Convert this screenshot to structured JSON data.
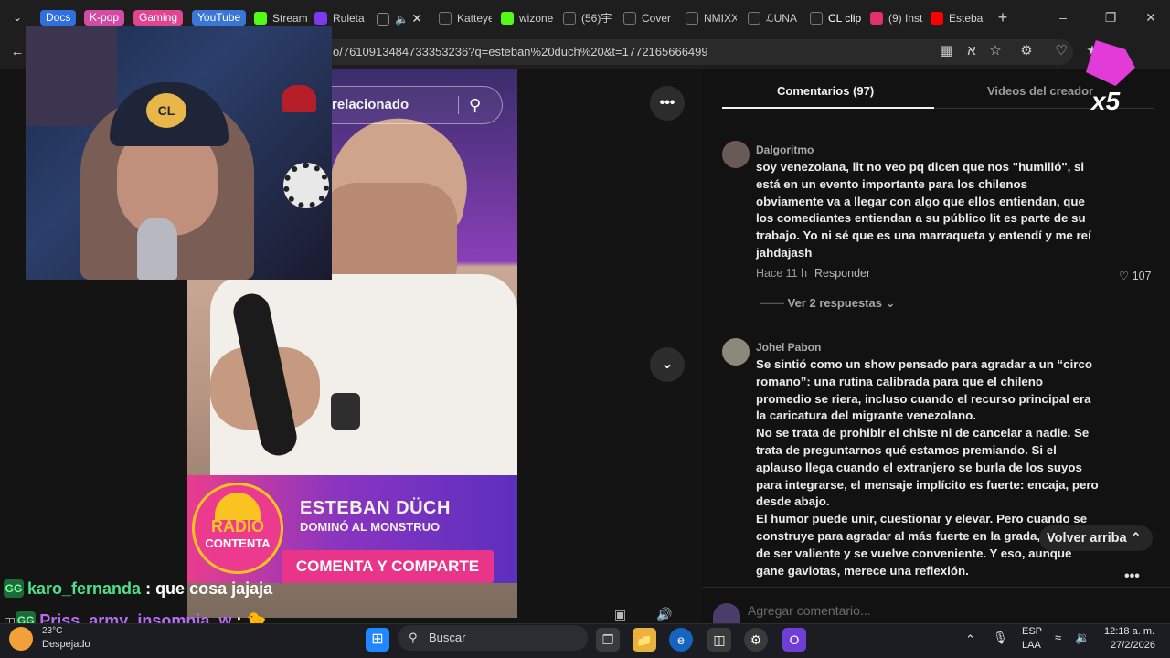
{
  "tabbar": {
    "groups": [
      {
        "label": "Docs",
        "color": "#2f6fe0"
      },
      {
        "label": "K-pop",
        "color": "#d24ba5"
      },
      {
        "label": "Gaming",
        "color": "#e0468f"
      },
      {
        "label": "YouTube",
        "color": "#3a76d6"
      }
    ],
    "tabs": [
      {
        "label": "Stream",
        "icon": "kick-icon",
        "color": "#53fc18"
      },
      {
        "label": "Ruleta",
        "icon": "wheel-icon",
        "color": "#7c3aed"
      },
      {
        "label": "Katteye",
        "icon": "tiktok-icon",
        "color": "#222222"
      },
      {
        "label": "wizone",
        "icon": "kick-icon",
        "color": "#53fc18"
      },
      {
        "label": "(56)宇",
        "icon": "tiktok-icon",
        "color": "#222222"
      },
      {
        "label": "Cover c",
        "icon": "tiktok-icon",
        "color": "#222222"
      },
      {
        "label": "NMIXX",
        "icon": "tiktok-icon",
        "color": "#222222"
      },
      {
        "label": "ℒUNA B",
        "icon": "tiktok-icon",
        "color": "#222222"
      },
      {
        "label": "CL clip",
        "icon": "tiktok-icon",
        "color": "#222222"
      },
      {
        "label": "(9) Inst",
        "icon": "instagram-icon",
        "color": "#e1306c"
      },
      {
        "label": "Esteba",
        "icon": "youtube-icon",
        "color": "#ff0000"
      }
    ]
  },
  "toolbar": {
    "url": "o/7610913484733353236?q=esteban%20duch%20&t=1772165666499"
  },
  "video": {
    "search_text": "relacionado",
    "banner_logo_line1": "RADIO",
    "banner_logo_line2": "CONTENTA",
    "banner_title": "ESTEBAN DÜCH",
    "banner_subtitle": "DOMINÓ AL MONSTRUO",
    "banner_cta": "COMENTA Y COMPARTE"
  },
  "chat": [
    {
      "user": "karo_fernanda",
      "message": "que cosa jajaja",
      "color": "#4ee08a"
    },
    {
      "user": "Priss_army_insomnia_w",
      "message": "🐤",
      "color": "#b56cf5"
    }
  ],
  "weather": {
    "temp": "23°C",
    "condition": "Despejado"
  },
  "comments_panel": {
    "tab_comments": "Comentarios (97)",
    "tab_creator": "Videos del creador",
    "comments": [
      {
        "user": "Dalgoritmo",
        "text_lines": [
          "soy venezolana, lit no veo pq dicen que nos \"humilló\", si",
          "está en un evento importante para los chilenos",
          "obviamente va a llegar con algo que ellos entiendan, que",
          "los comediantes entiendan a su público lit es parte de su",
          "trabajo. Yo ni sé que es una marraqueta y entendí y me reí",
          "jahdajash"
        ],
        "time": "Hace 11 h",
        "reply": "Responder",
        "likes": "107",
        "replies": "Ver 2 respuestas"
      },
      {
        "user": "Johel Pabon",
        "text_lines": [
          "Se sintió como un show pensado para agradar a un “circo",
          "romano”: una rutina calibrada para que el chileno",
          "promedio se riera, incluso cuando el recurso principal era",
          "la caricatura del migrante venezolano.",
          "No se trata de prohibir el chiste ni de cancelar a nadie. Se",
          "trata de preguntarnos qué estamos premiando. Si el",
          "aplauso llega cuando el extranjero se burla de los suyos",
          "para integrarse, el mensaje implícito es fuerte: encaja, pero",
          "desde abajo.",
          "El humor puede unir, cuestionar y elevar. Pero cuando se",
          "construye para agradar al más fuerte en la grada, deja",
          "de ser valiente y se vuelve conveniente. Y eso, aunque",
          "gane gaviotas, merece una reflexión."
        ]
      }
    ],
    "back_to_top": "Volver arriba",
    "add_comment_placeholder": "Agregar comentario...",
    "gift_label": "x5"
  },
  "taskbar": {
    "search": "Buscar",
    "lang1": "ESP",
    "lang2": "LAA",
    "time": "12:18 a. m.",
    "date": "27/2/2026"
  }
}
